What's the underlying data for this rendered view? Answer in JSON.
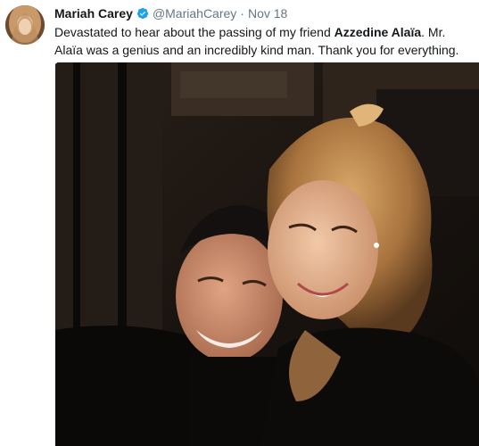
{
  "tweet": {
    "author_name": "Mariah Carey",
    "handle": "@MariahCarey",
    "separator": "·",
    "timestamp": "Nov 18",
    "text_part1": "Devastated to hear about the passing of my friend ",
    "text_bold": "Azzedine Alaïa",
    "text_part2": ". Mr. Alaïa was a genius and an incredibly kind man. Thank you for everything. R.I.P."
  },
  "icons": {
    "verified": "verified-badge-icon",
    "avatar": "profile-avatar"
  },
  "colors": {
    "verified_blue": "#1da1f2",
    "secondary_text": "#657786",
    "primary_text": "#14171a"
  }
}
